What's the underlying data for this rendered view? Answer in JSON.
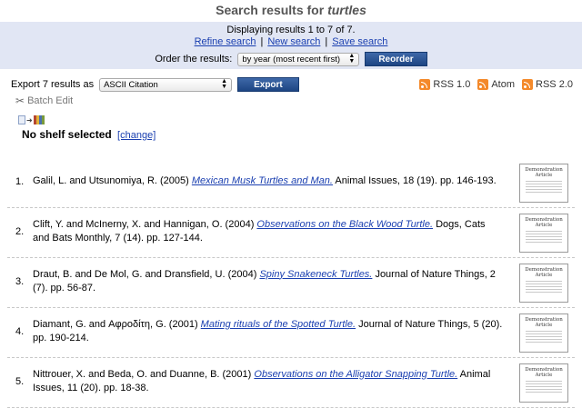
{
  "header": {
    "title_prefix": "Search results for",
    "query": "turtles"
  },
  "search_controls": {
    "displaying_text": "Displaying results 1 to 7 of 7.",
    "links": {
      "refine": "Refine search",
      "new": "New search",
      "save": "Save search",
      "separator": "|"
    },
    "order_label": "Order the results:",
    "order_selected": "by year (most recent first)",
    "reorder_button": "Reorder"
  },
  "export": {
    "label": "Export 7 results as",
    "format_selected": "ASCII Citation",
    "button": "Export"
  },
  "feeds": [
    {
      "label": "RSS 1.0",
      "icon": "rss-icon"
    },
    {
      "label": "Atom",
      "icon": "rss-icon"
    },
    {
      "label": "RSS 2.0",
      "icon": "rss-icon"
    }
  ],
  "batch_edit": {
    "label": "Batch Edit",
    "icon": "tools-icon"
  },
  "shelf": {
    "label": "No shelf selected",
    "change_link": "[change]"
  },
  "results": [
    {
      "num": "1.",
      "authors": "Galil, L. and Utsunomiya, R. (2005)",
      "title": "Mexican Musk Turtles and Man.",
      "source": "Animal Issues, 18 (19). pp. 146-193.",
      "thumb": [
        "Demonstration",
        "Article"
      ]
    },
    {
      "num": "2.",
      "authors": "Clift, Y. and McInerny, X. and Hannigan, O. (2004)",
      "title": "Observations on the Black Wood Turtle.",
      "source": "Dogs, Cats and Bats Monthly, 7 (14). pp. 127-144.",
      "thumb": [
        "Demonstration",
        "Article"
      ]
    },
    {
      "num": "3.",
      "authors": "Draut, B. and De Mol, G. and Dransfield, U. (2004)",
      "title": "Spiny Snakeneck Turtles.",
      "source": "Journal of Nature Things, 2 (7). pp. 56-87.",
      "thumb": [
        "Demonstration",
        "Article"
      ]
    },
    {
      "num": "4.",
      "authors": "Diamant, G. and Αφροδίτη, G. (2001)",
      "title": "Mating rituals of the Spotted Turtle.",
      "source": "Journal of Nature Things, 5 (20). pp. 190-214.",
      "thumb": [
        "Demonstration",
        "Article"
      ]
    },
    {
      "num": "5.",
      "authors": "Nittrouer, X. and Beda, O. and Duanne, B. (2001)",
      "title": "Observations on the Alligator Snapping Turtle.",
      "source": "Animal Issues, 11 (20). pp. 18-38.",
      "thumb": [
        "Demonstration",
        "Article"
      ]
    }
  ]
}
